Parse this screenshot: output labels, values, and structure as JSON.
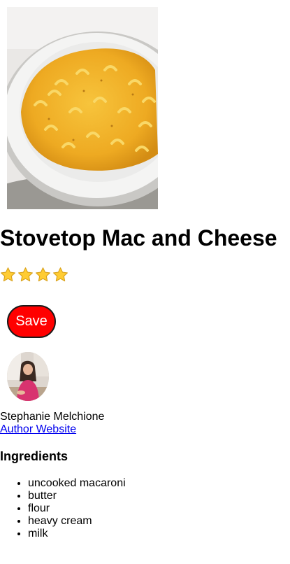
{
  "recipe": {
    "title": "Stovetop Mac and Cheese",
    "rating": 4,
    "save_label": "Save"
  },
  "author": {
    "name": "Stephanie Melchione",
    "website_label": "Author Website"
  },
  "ingredients": {
    "heading": "Ingredients",
    "items": [
      "uncooked macaroni",
      "butter",
      "flour",
      "heavy cream",
      "milk"
    ]
  },
  "colors": {
    "save_button": "#ff0000",
    "link": "#0000ee",
    "star": "#ffcc33"
  }
}
